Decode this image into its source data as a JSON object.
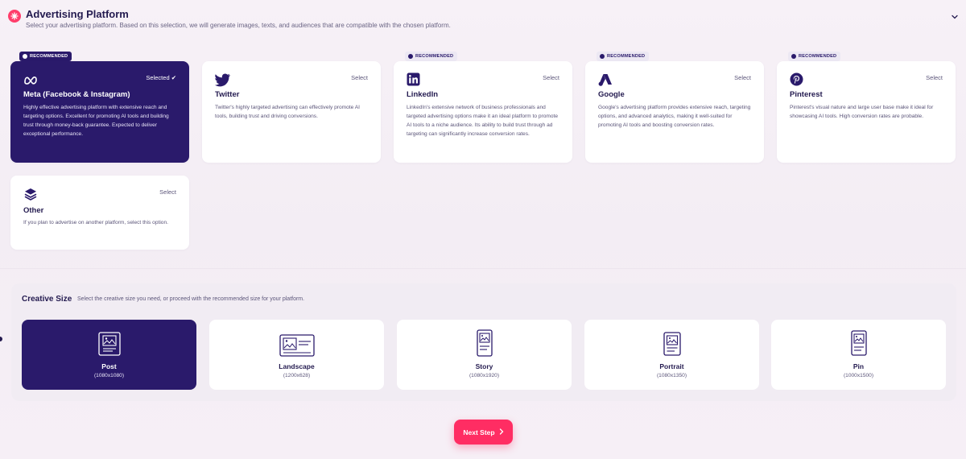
{
  "header": {
    "title": "Advertising Platform",
    "subtitle": "Select your advertising platform. Based on this selection, we will generate images, texts, and audiences that are compatible with the chosen platform."
  },
  "platforms": [
    {
      "name": "Meta (Facebook & Instagram)",
      "action": "Selected",
      "selected": true,
      "badge": "RECOMMENDED",
      "icon": "meta-icon",
      "description": "Highly effective advertising platform with extensive reach and targeting options. Excellent for promoting AI tools and building trust through money-back guarantee. Expected to deliver exceptional performance."
    },
    {
      "name": "Twitter",
      "action": "Select",
      "selected": false,
      "badge": "",
      "icon": "twitter-icon",
      "description": "Twitter's highly targeted advertising can effectively promote AI tools, building trust and driving conversions."
    },
    {
      "name": "LinkedIn",
      "action": "Select",
      "selected": false,
      "badge": "RECOMMENDED",
      "icon": "linkedin-icon",
      "description": "LinkedIn's extensive network of business professionals and targeted advertising options make it an ideal platform to promote AI tools to a niche audience. Its ability to build trust through ad targeting can significantly increase conversion rates."
    },
    {
      "name": "Google",
      "action": "Select",
      "selected": false,
      "badge": "RECOMMENDED",
      "icon": "google-ads-icon",
      "description": "Google's advertising platform provides extensive reach, targeting options, and advanced analytics, making it well-suited for promoting AI tools and boosting conversion rates."
    },
    {
      "name": "Pinterest",
      "action": "Select",
      "selected": false,
      "badge": "RECOMMENDED",
      "icon": "pinterest-icon",
      "description": "Pinterest's visual nature and large user base make it ideal for showcasing AI tools. High conversion rates are probable."
    },
    {
      "name": "Other",
      "action": "Select",
      "selected": false,
      "badge": "",
      "icon": "layers-icon",
      "description": "If you plan to advertise on another platform, select this option."
    }
  ],
  "creative": {
    "title": "Creative Size",
    "subtitle": "Select the creative size you need, or proceed with the recommended size for your platform.",
    "sizes": [
      {
        "name": "Post",
        "dims": "(1080x1080)",
        "selected": true,
        "icon": "post-icon"
      },
      {
        "name": "Landscape",
        "dims": "(1200x628)",
        "selected": false,
        "icon": "landscape-icon"
      },
      {
        "name": "Story",
        "dims": "(1080x1920)",
        "selected": false,
        "icon": "story-icon"
      },
      {
        "name": "Portrait",
        "dims": "(1080x1350)",
        "selected": false,
        "icon": "portrait-icon"
      },
      {
        "name": "Pin",
        "dims": "(1000x1500)",
        "selected": false,
        "icon": "pin-icon"
      }
    ]
  },
  "next_button": {
    "label": "Next Step"
  },
  "colors": {
    "accent": "#ff2d63",
    "primary": "#2a1a6b"
  }
}
